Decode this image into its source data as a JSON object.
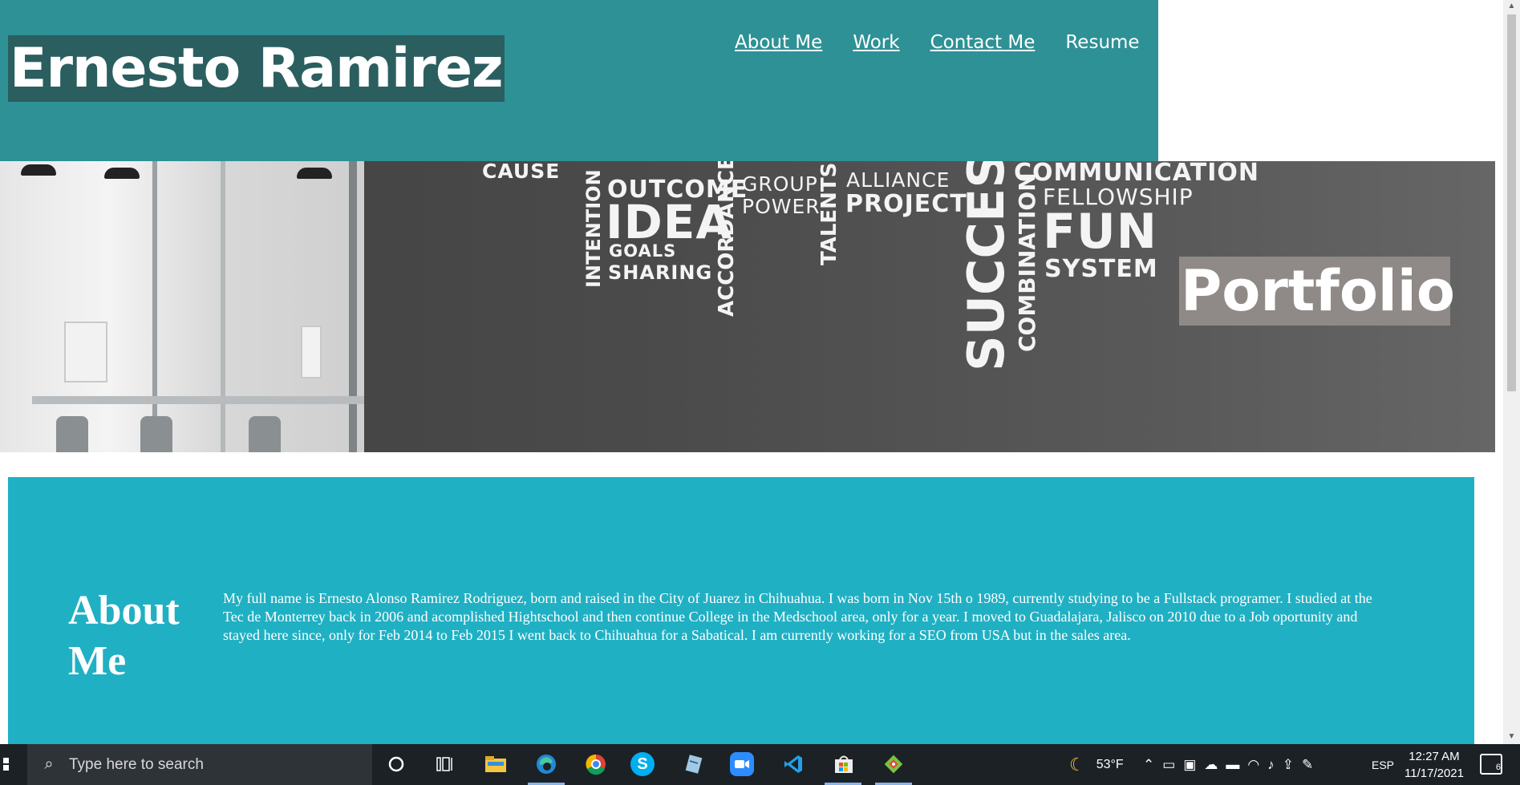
{
  "header": {
    "title": "Ernesto Ramirez",
    "nav": [
      {
        "label": "About Me"
      },
      {
        "label": "Work"
      },
      {
        "label": "Contact Me"
      },
      {
        "label": "Resume"
      }
    ]
  },
  "hero": {
    "words": {
      "cause": "CAUSE",
      "outcome": "OUTCOME",
      "idea": "IDEA",
      "goals": "GOALS",
      "sharing": "SHARING",
      "group": "GROUP",
      "power": "POWER",
      "alliance": "ALLIANCE",
      "project": "PROJECT",
      "communication": "COMMUNICATION",
      "fellowship": "FELLOWSHIP",
      "fun": "FUN",
      "system": "SYSTEM",
      "intention": "INTENTION",
      "accordance": "ACCORDANCE",
      "talents": "TALENTS",
      "success": "SUCCESS",
      "combination": "COMBINATION"
    },
    "label": "Portfolio"
  },
  "about": {
    "heading": "About Me",
    "text": "My full name is Ernesto Alonso Ramirez Rodriguez, born and raised in the City of Juarez in Chihuahua. I was born in Nov 15th o 1989, currently studying to be a Fullstack programer. I studied at the Tec de Monterrey back in 2006 and acomplished Hightschool and then continue College in the Medschool area, only for a year. I moved to Guadalajara, Jalisco on 2010 due to a Job oportunity and stayed here since, only for Feb 2014 to Feb 2015 I went back to Chihuahua for a Sabatical. I am currently working for a SEO from USA but in the sales area."
  },
  "taskbar": {
    "search_placeholder": "Type here to search",
    "apps": [
      "cortana-icon",
      "task-view-icon",
      "file-explorer-icon",
      "edge-icon",
      "chrome-icon",
      "skype-icon",
      "notepad-icon",
      "zoom-icon",
      "vscode-icon",
      "store-icon",
      "git-icon"
    ],
    "weather": "53°F",
    "language": "ESP",
    "time": "12:27 AM",
    "date": "11/17/2021",
    "notifications": "6"
  },
  "colors": {
    "header_bg": "#2e9196",
    "title_bg": "#2b5e5f",
    "about_bg": "#20b0c3",
    "portfolio_label_bg": "#8f8a87",
    "taskbar_bg": "#1c2126"
  }
}
